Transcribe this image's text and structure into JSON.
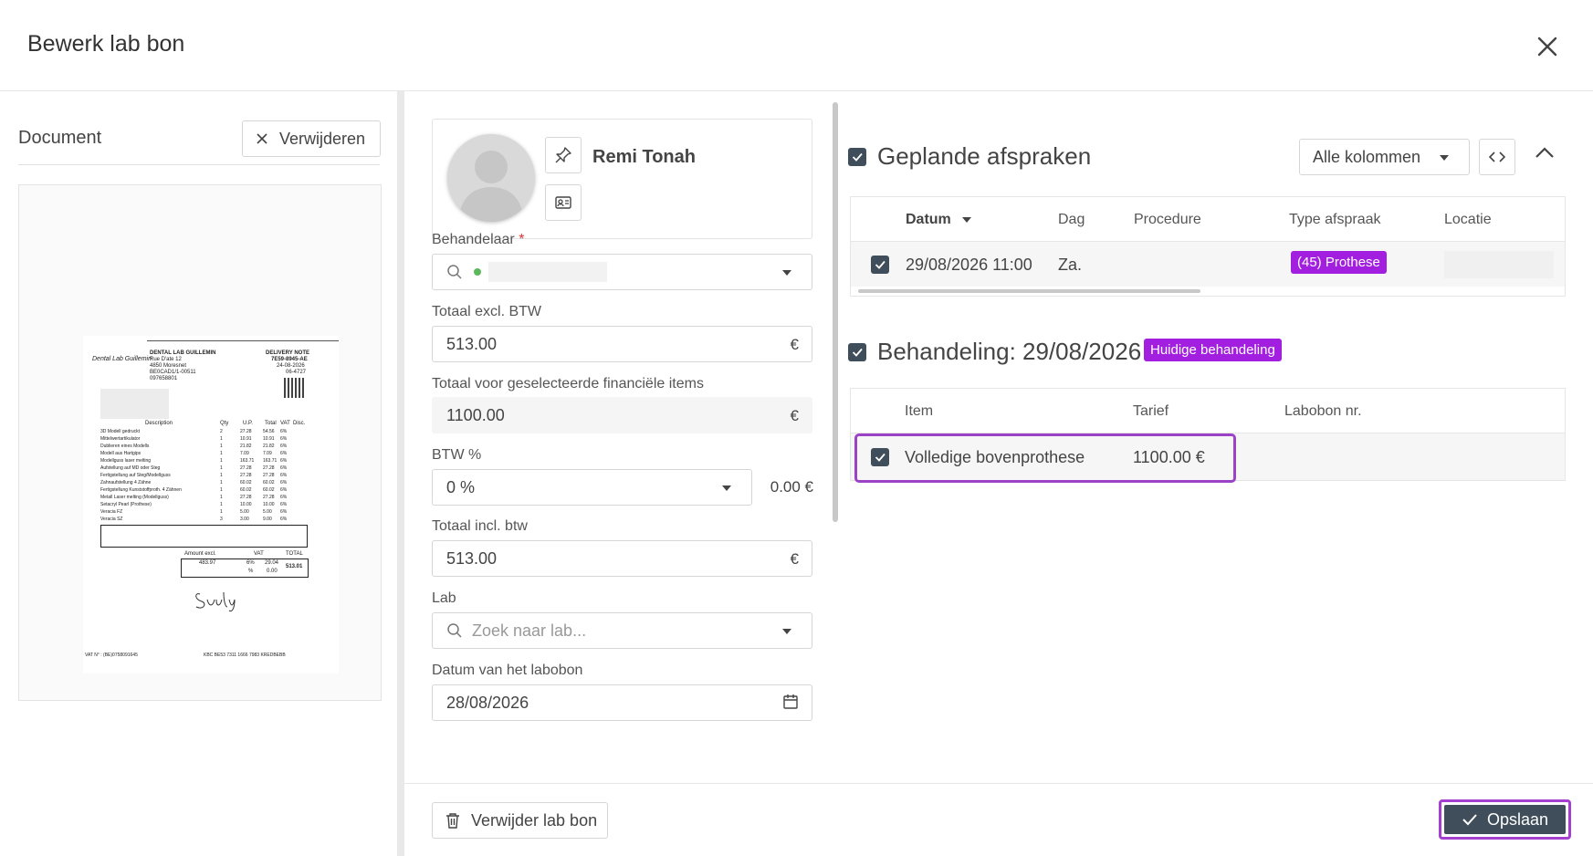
{
  "header": {
    "title": "Bewerk lab bon"
  },
  "document_panel": {
    "label": "Document",
    "remove_label": "Verwijderen",
    "paper": {
      "lab_name": "DENTAL LAB GUILLEMIN",
      "lab_logo": "Dental Lab Guillemin",
      "address_1": "Rue D'ate 12",
      "address_2": "4850 Moresnet",
      "address_3": "BE0CAD1/1-00511",
      "address_4": "097658801",
      "doc_type": "DELIVERY NOTE",
      "doc_no": "7E59-8945-AE",
      "doc_date": "24-08-2026",
      "doc_ref": "06-4727",
      "col_description": "Description",
      "col_qty": "Qty",
      "col_up": "U.P.",
      "col_total": "Total",
      "col_vat": "VAT",
      "col_disc": "Disc.",
      "rows": [
        [
          "3D Modell gedruckt",
          "2",
          "27.28",
          "54.56",
          "6%"
        ],
        [
          "Mittelwertartikulator",
          "1",
          "10.91",
          "10.91",
          "6%"
        ],
        [
          "Dublieren eines Modells",
          "1",
          "21.82",
          "21.82",
          "6%"
        ],
        [
          "Modell aus Hartgips",
          "1",
          "7.09",
          "7.09",
          "6%"
        ],
        [
          "Modellguss laser melting",
          "1",
          "163.71",
          "163.71",
          "6%"
        ],
        [
          "Aufstellung auf MD oder Steg",
          "1",
          "27.28",
          "27.28",
          "6%"
        ],
        [
          "Fertigstellung auf Steg/Modellguss",
          "1",
          "27.28",
          "27.28",
          "6%"
        ],
        [
          "Zahnaufstellung 4 Zähne",
          "1",
          "60.02",
          "60.02",
          "6%"
        ],
        [
          "Fertigstellung Kunststoffproth. 4 Zähnen",
          "1",
          "60.02",
          "60.02",
          "6%"
        ],
        [
          "Metall Laser melting (Modellguss)",
          "1",
          "27.28",
          "27.28",
          "6%"
        ],
        [
          "Setacryl Pearl (Prothese)",
          "1",
          "10.00",
          "10.00",
          "6%"
        ],
        [
          "Veracia FZ",
          "1",
          "5.00",
          "5.00",
          "6%"
        ],
        [
          "Veracia SZ",
          "3",
          "3.00",
          "9.00",
          "6%"
        ]
      ],
      "sum_amount_excl": "Amount excl.",
      "sum_vat": "VAT",
      "sum_total": "TOTAL",
      "sum_amount_val": "483.97",
      "sum_vat_pct": "6%",
      "sum_vat_val": "29.04",
      "sum_total_val": "513.01",
      "sum_pct": "%",
      "sum_zero": "0.00",
      "footer_vat": "VAT N° : (BE)0758091645",
      "footer_bank": "KBC BE53 7311 1666 7983 KREDBEBB"
    }
  },
  "form": {
    "patient_name": "Remi Tonah",
    "behandelaar_label": "Behandelaar",
    "required_mark": "*",
    "totaal_excl_label": "Totaal excl. BTW",
    "totaal_excl_value": "513.00",
    "totaal_fin_label": "Totaal voor geselecteerde financiële items",
    "totaal_fin_value": "1100.00",
    "btw_label": "BTW %",
    "btw_value": "0 %",
    "btw_amount": "0.00 €",
    "totaal_incl_label": "Totaal incl. btw",
    "totaal_incl_value": "513.00",
    "currency": "€",
    "lab_label": "Lab",
    "lab_placeholder": "Zoek naar lab...",
    "datum_label": "Datum van het labobon",
    "datum_value": "28/08/2026",
    "delete_label": "Verwijder lab bon"
  },
  "appointments": {
    "title": "Geplande afspraken",
    "columns_select": "Alle kolommen",
    "headers": {
      "datum": "Datum",
      "dag": "Dag",
      "procedure": "Procedure",
      "type": "Type afspraak",
      "locatie": "Locatie"
    },
    "rows": [
      {
        "datum": "29/08/2026 11:00",
        "dag": "Za.",
        "procedure": "",
        "type": "(45) Prothese"
      }
    ]
  },
  "treatment": {
    "title": "Behandeling: 29/08/2026",
    "badge": "Huidige behandeling",
    "headers": {
      "item": "Item",
      "tarief": "Tarief",
      "labobon": "Labobon nr."
    },
    "rows": [
      {
        "item": "Volledige bovenprothese",
        "tarief": "1100.00 €",
        "labobon": ""
      }
    ]
  },
  "footer": {
    "save_label": "Opslaan"
  },
  "colors": {
    "accent": "#3f4e5a",
    "badge": "#a31fe0",
    "highlight": "#9b42c6",
    "status_dot": "#5cb85c"
  }
}
